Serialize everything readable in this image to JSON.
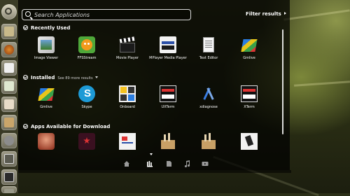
{
  "search": {
    "placeholder": "Search Applications"
  },
  "filter": {
    "label": "Filter results"
  },
  "sections": {
    "recent": {
      "title": "Recently Used"
    },
    "installed": {
      "title": "Installed",
      "more": "See 89 more results"
    },
    "download": {
      "title": "Apps Available for Download"
    }
  },
  "recent_apps": [
    "Image Viewer",
    "FFSStream",
    "Movie Player",
    "MPlayer Media Player",
    "Text Editor",
    "Gmlive"
  ],
  "installed_apps": [
    "Gmlive",
    "Skype",
    "Onboard",
    "UXTerm",
    "xdiagnose",
    "XTerm"
  ],
  "icons": {
    "launcher": [
      "dash-home-icon",
      "folder-icon",
      "web-browser-icon",
      "document-icon",
      "spreadsheet-icon",
      "presentation-icon",
      "software-center-icon",
      "settings-icon",
      "workspace-icon",
      "terminal-icon",
      "trash-icon"
    ],
    "lenses": [
      "home-lens-icon",
      "applications-lens-icon",
      "files-lens-icon",
      "music-lens-icon",
      "video-lens-icon"
    ]
  },
  "colors": {
    "accent": "#ffffff",
    "dash_bg": "#000000"
  }
}
